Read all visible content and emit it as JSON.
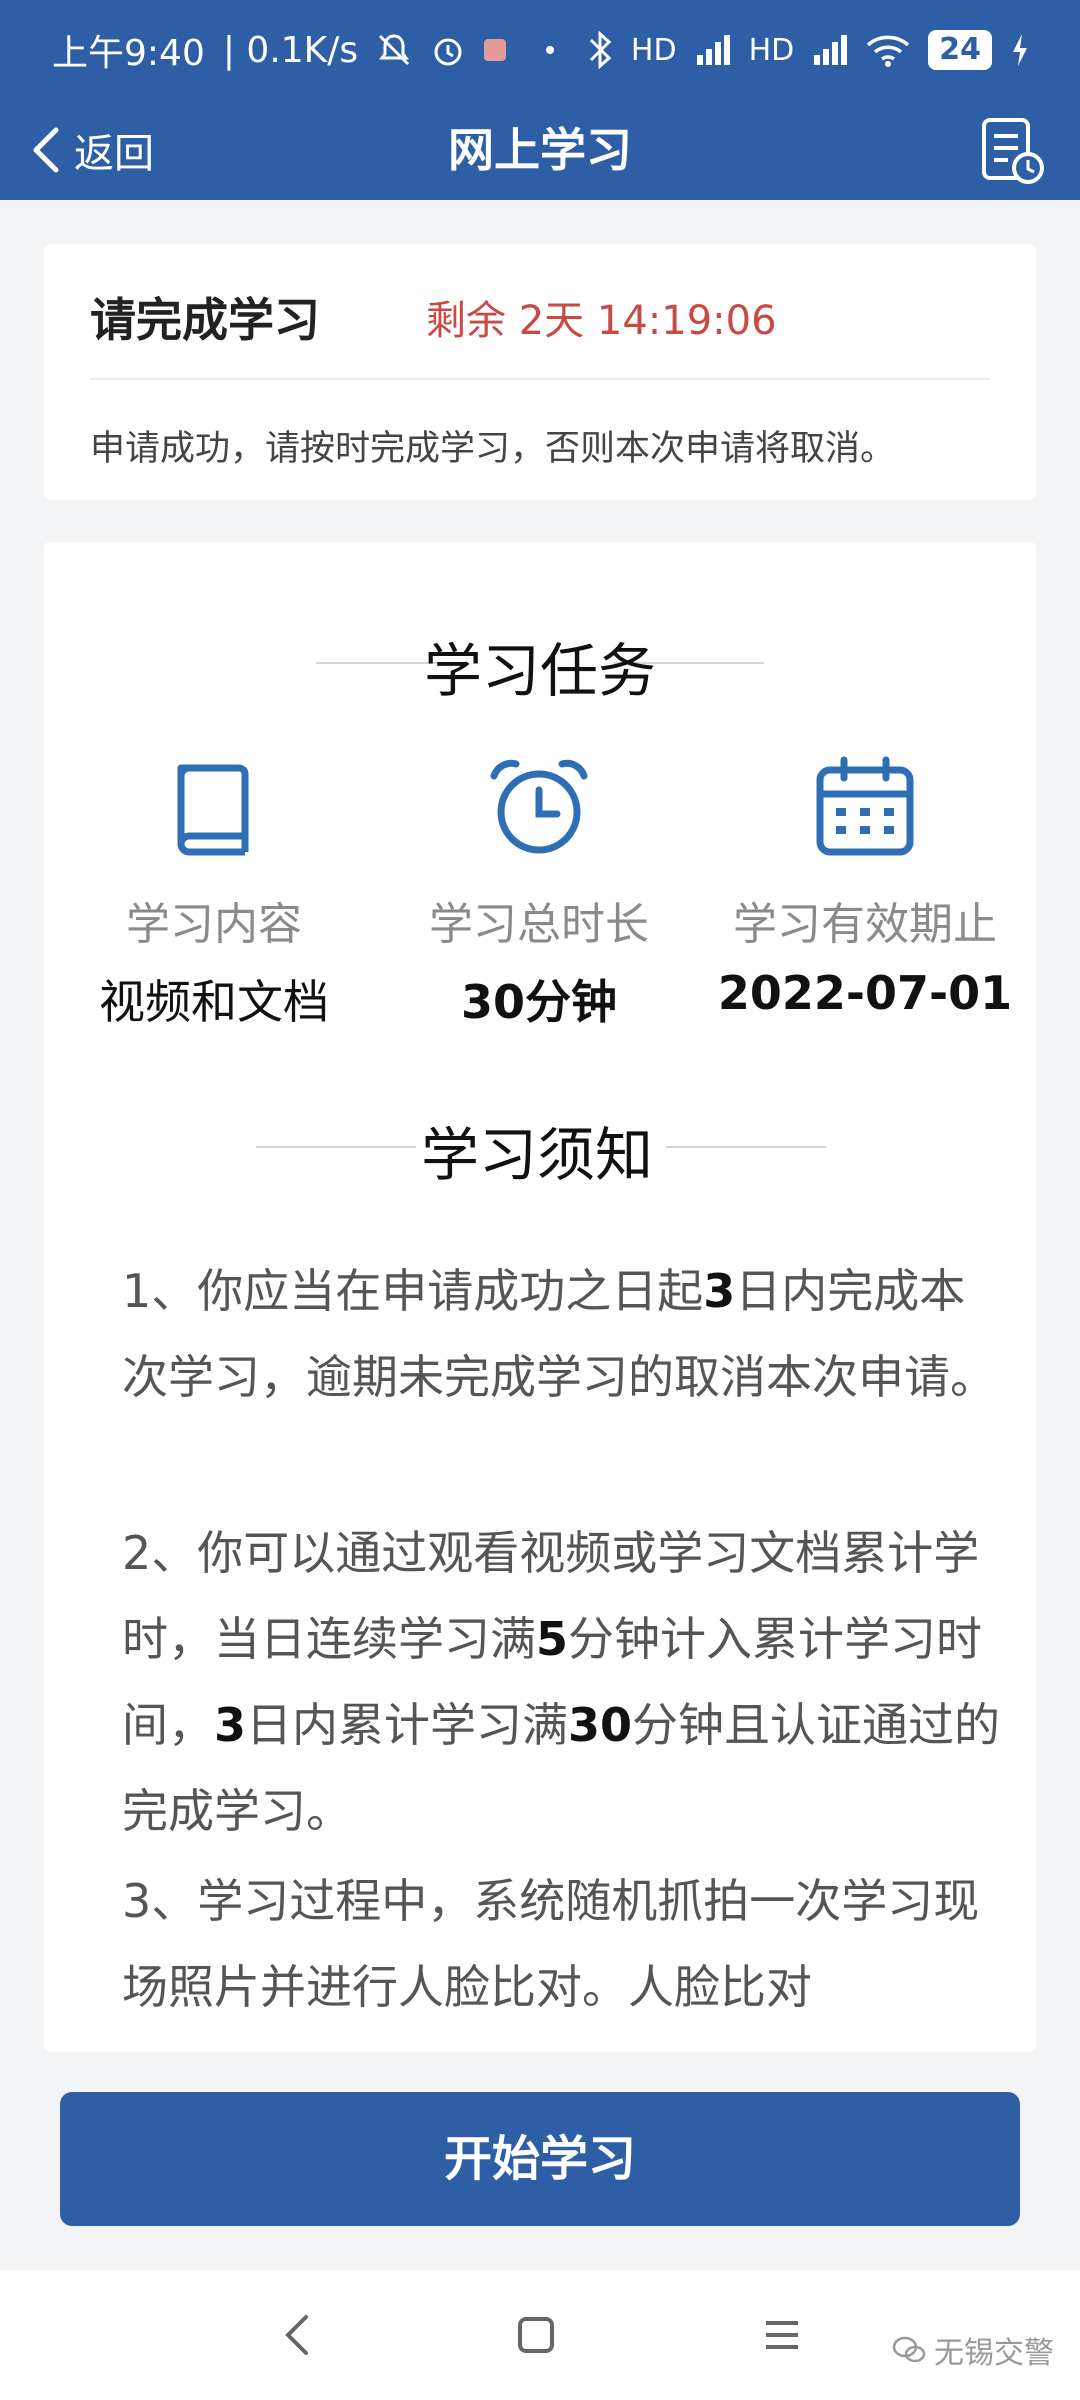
{
  "status_bar": {
    "time": "上午9:40",
    "speed": "| 0.1K/s",
    "signal1": "HD",
    "signal2": "HD",
    "battery": "24"
  },
  "header": {
    "back_label": "返回",
    "title": "网上学习"
  },
  "notice_card": {
    "title": "请完成学习",
    "remaining": "剩余 2天 14:19:06",
    "message": "申请成功，请按时完成学习，否则本次申请将取消。"
  },
  "tasks": {
    "section_title": "学习任务",
    "items": [
      {
        "label": "学习内容",
        "value": "视频和文档"
      },
      {
        "label": "学习总时长",
        "value": "30分钟"
      },
      {
        "label": "学习有效期止",
        "value": "2022-07-01"
      }
    ]
  },
  "rules": {
    "section_title": "学习须知",
    "items": [
      {
        "a": "1、你应当在申请成功之日起",
        "b": "3",
        "c": "日内完成本次学习，逾期未完成学习的取消本次申请。"
      },
      {
        "a": "2、你可以通过观看视频或学习文档累计学时，当日连续学习满",
        "b": "5",
        "c": "分钟计入累计学习时间，",
        "d": "3",
        "e": "日内累计学习满",
        "f": "30",
        "g": "分钟且认证通过的完成学习。"
      },
      {
        "a": "3、学习过程中，系统随机抓拍一次学习现场照片并进行人脸比对。人脸比对"
      }
    ]
  },
  "start_button": "开始学习",
  "watermark": "无锡交警",
  "colors": {
    "primary": "#2e5fa6",
    "countdown": "#c94a43",
    "icon": "#2e6eb5"
  }
}
